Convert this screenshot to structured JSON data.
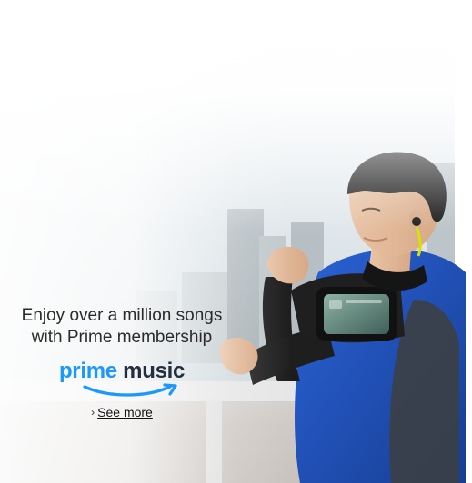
{
  "promo": {
    "headline_line1": "Enjoy over a million songs",
    "headline_line2": "with Prime membership",
    "logo_prime": "prime",
    "logo_music": "music",
    "see_more_label": "See more",
    "see_more_icon": "chevron-right-icon"
  },
  "colors": {
    "prime_blue": "#1a98ff",
    "music_dark": "#232f3e",
    "text": "#2b2b2b",
    "jacket_blue": "#1f4fb5"
  }
}
